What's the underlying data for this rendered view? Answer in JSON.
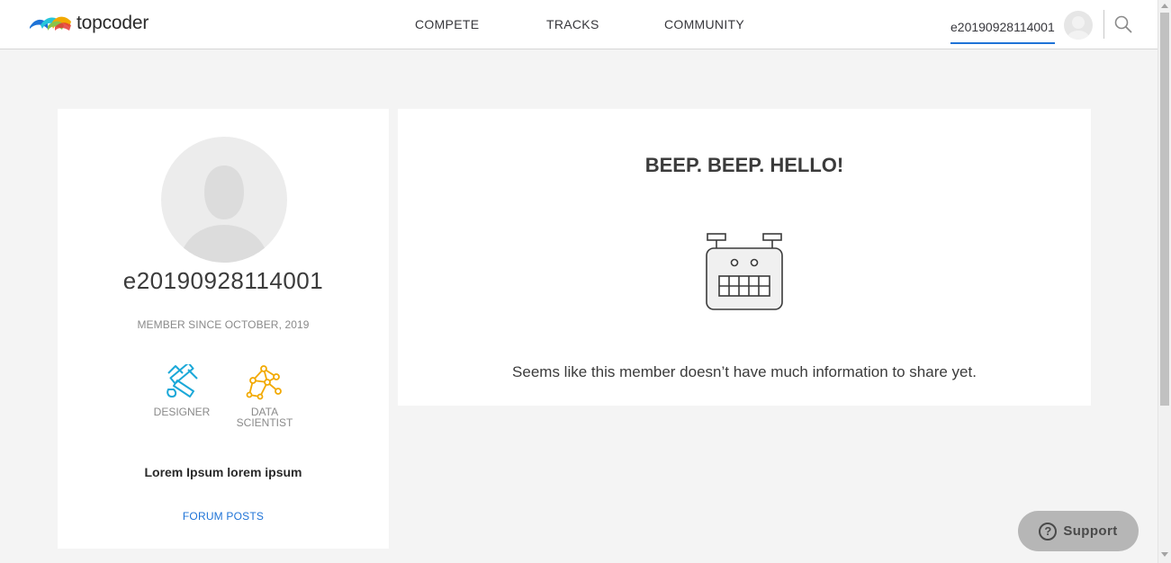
{
  "header": {
    "logo_text": "topcoder",
    "nav": [
      {
        "label": "COMPETE"
      },
      {
        "label": "TRACKS"
      },
      {
        "label": "COMMUNITY"
      }
    ],
    "user_handle": "e20190928114001"
  },
  "profile": {
    "handle": "e20190928114001",
    "member_since": "MEMBER SINCE OCTOBER, 2019",
    "tracks": [
      {
        "label": "DESIGNER",
        "icon": "designer-icon",
        "color": "#1ba8d8"
      },
      {
        "label_line1": "DATA",
        "label_line2": "SCIENTIST",
        "icon": "data-scientist-icon",
        "color": "#f2a900"
      }
    ],
    "description": "Lorem Ipsum lorem ipsum",
    "forum_link": "FORUM POSTS"
  },
  "info": {
    "title": "BEEP. BEEP. HELLO!",
    "message": "Seems like this member doesn’t have much information to share yet.",
    "icon": "robot-icon"
  },
  "support": {
    "label": "Support",
    "icon_glyph": "?"
  },
  "colors": {
    "accent": "#1e73d7",
    "page_bg": "#f4f4f4",
    "card_bg": "#ffffff"
  }
}
